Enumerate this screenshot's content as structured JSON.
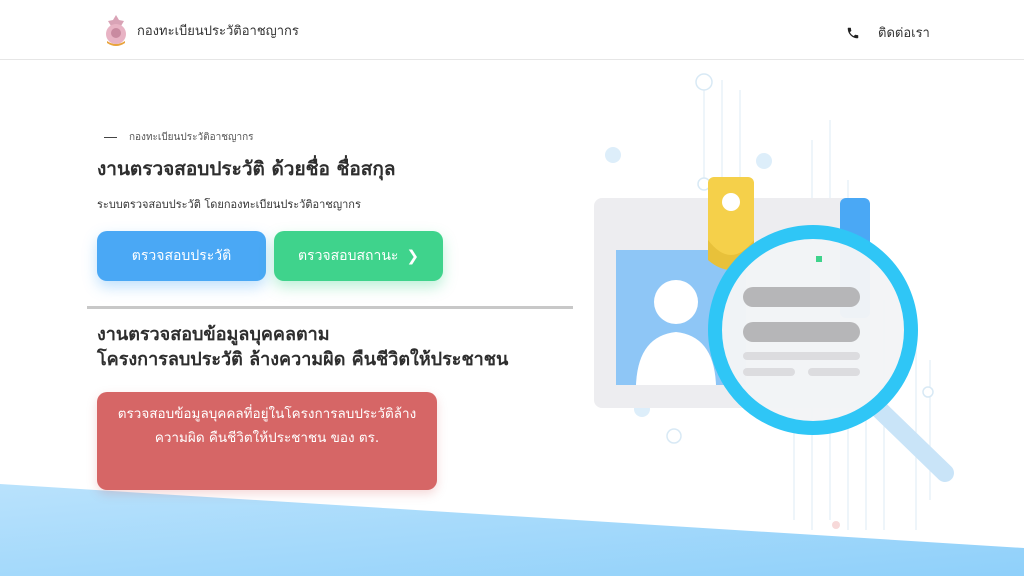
{
  "header": {
    "brand": "กองทะเบียนประวัติอาชญากร",
    "contact_label": "ติดต่อเรา"
  },
  "hero": {
    "eyebrow": "กองทะเบียนประวัติอาชญากร",
    "title": "งานตรวจสอบประวัติ ด้วยชื่อ ชื่อสกุล",
    "subtitle": "ระบบตรวจสอบประวัติ โดยกองทะเบียนประวัติอาชญากร",
    "check_history_button": "ตรวจสอบประวัติ",
    "check_status_button": "ตรวจสอบสถานะ"
  },
  "section2": {
    "title_line1": "งานตรวจสอบข้อมูลบุคคลตาม",
    "title_line2": "โครงการลบประวัติ ล้างความผิด คืนชีวิตให้ประชาชน",
    "project_button": "ตรวจสอบข้อมูลบุคคลที่อยู่ในโครงการลบประวัติล้างความผิด คืนชีวิตให้ประชาชน ของ ตร."
  },
  "colors": {
    "primary_blue": "#4aa8f5",
    "success_green": "#3fd38c",
    "danger_red": "#d66666",
    "wave_light_blue": "#9fd6fb"
  },
  "icons": {
    "logo": "police-emblem-icon",
    "contact": "phone-icon",
    "status_chevron": "chevron-right-icon"
  }
}
